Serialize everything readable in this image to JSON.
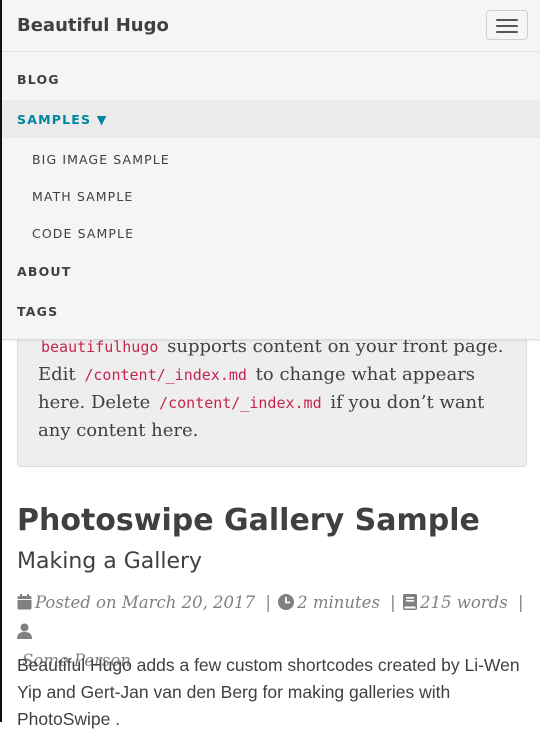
{
  "navbar": {
    "brand": "Beautiful Hugo"
  },
  "menu": {
    "items": [
      {
        "label": "BLOG"
      },
      {
        "label": "SAMPLES ▼"
      },
      {
        "label": "ABOUT"
      },
      {
        "label": "TAGS"
      }
    ],
    "sub_items": [
      {
        "label": "BIG IMAGE SAMPLE"
      },
      {
        "label": "MATH SAMPLE"
      },
      {
        "label": "CODE SAMPLE"
      }
    ]
  },
  "intro": {
    "code1": "beautifulhugo",
    "text1": " supports content on your front page. Edit ",
    "code2": "/content/_index.md",
    "text2": " to change what appears here. Delete ",
    "code3": "/content/_index.md",
    "text3": " if you don’t want any content here."
  },
  "post": {
    "title": "Photoswipe Gallery Sample",
    "subtitle": "Making a Gallery",
    "date": "Posted on March 20, 2017",
    "reading_time": "2 minutes",
    "word_count": "215 words",
    "author": "Some Person",
    "separator": "|",
    "body": "Beautiful Hugo adds a few custom shortcodes created by Li-Wen Yip and Gert-Jan van den Berg for making galleries with PhotoSwipe ."
  },
  "colors": {
    "accent": "#0085a1",
    "code": "#c7254e",
    "meta": "#808080"
  },
  "icons": [
    "hamburger-menu-icon",
    "calendar-icon",
    "clock-icon",
    "book-icon",
    "user-icon"
  ]
}
